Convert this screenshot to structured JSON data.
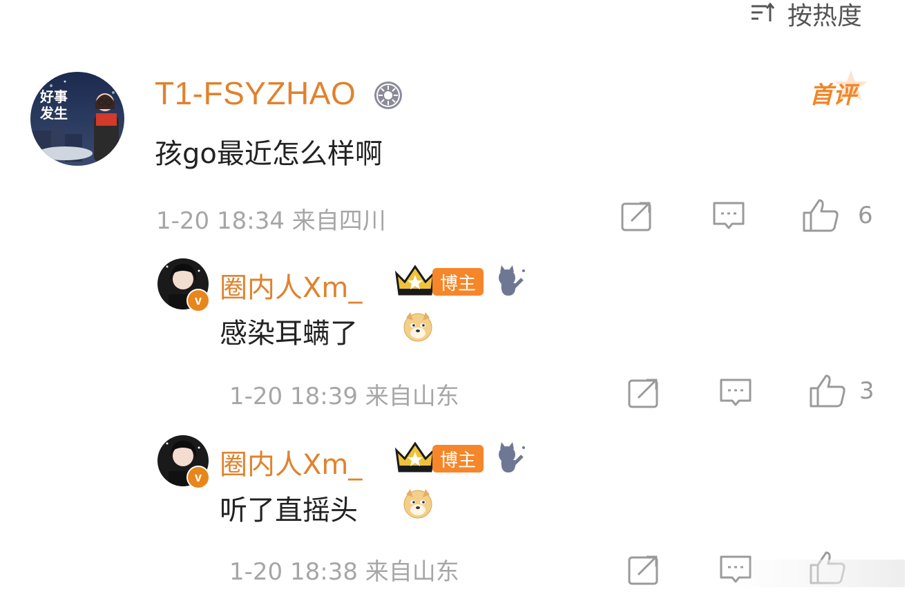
{
  "sort": {
    "label": "按热度"
  },
  "main_comment": {
    "avatar_text": "好事\n发生",
    "username": "T1-FSYZHAO",
    "badge_first": "首评",
    "text": "孩go最近怎么样啊",
    "meta": "1-20 18:34 来自四川",
    "like_count": "6"
  },
  "replies": [
    {
      "username": "圈内人Xm_",
      "tag": "博主",
      "text": "感染耳螨了",
      "meta": "1-20 18:39 来自山东",
      "like_count": "3"
    },
    {
      "username": "圈内人Xm_",
      "tag": "博主",
      "text": "听了直摇头",
      "meta": "1-20 18:38 来自山东",
      "like_count": ""
    }
  ],
  "colors": {
    "username": "#e0822c",
    "meta": "#a6a6a6",
    "icon": "#9a9a9a",
    "bozhu_bg": "#f5862a"
  }
}
